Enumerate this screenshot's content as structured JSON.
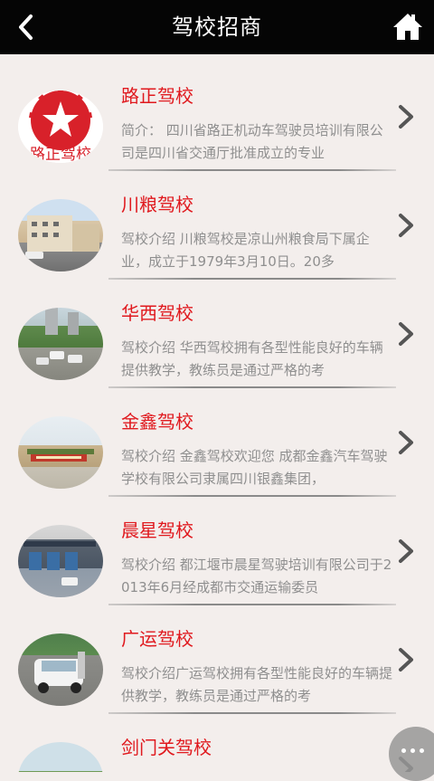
{
  "header": {
    "title": "驾校招商"
  },
  "items": [
    {
      "name": "路正驾校",
      "desc": "简介：  四川省路正机动车驾驶员培训有限公司是四川省交通厅批准成立的专业",
      "logo_text": "路正驾校"
    },
    {
      "name": "川粮驾校",
      "desc": "驾校介绍 川粮驾校是凉山州粮食局下属企业，成立于1979年3月10日。20多"
    },
    {
      "name": "华西驾校",
      "desc": "驾校介绍 华西驾校拥有各型性能良好的车辆提供教学，教练员是通过严格的考"
    },
    {
      "name": "金鑫驾校",
      "desc": "驾校介绍 金鑫驾校欢迎您 成都金鑫汽车驾驶学校有限公司隶属四川银鑫集团，"
    },
    {
      "name": "晨星驾校",
      "desc": "驾校介绍 都江堰市晨星驾驶培训有限公司于2013年6月经成都市交通运输委员"
    },
    {
      "name": "广运驾校",
      "desc": "驾校介绍广运驾校拥有各型性能良好的车辆提供教学，教练员是通过严格的考"
    },
    {
      "name": "剑门关驾校",
      "desc": ""
    }
  ],
  "icons": {
    "back": "chevron-left-icon",
    "home": "home-icon",
    "chevron": "chevron-right-icon",
    "more": "more-icon"
  },
  "colors": {
    "accent": "#e0191e",
    "topbar": "#050505",
    "background": "#f3eeec"
  }
}
